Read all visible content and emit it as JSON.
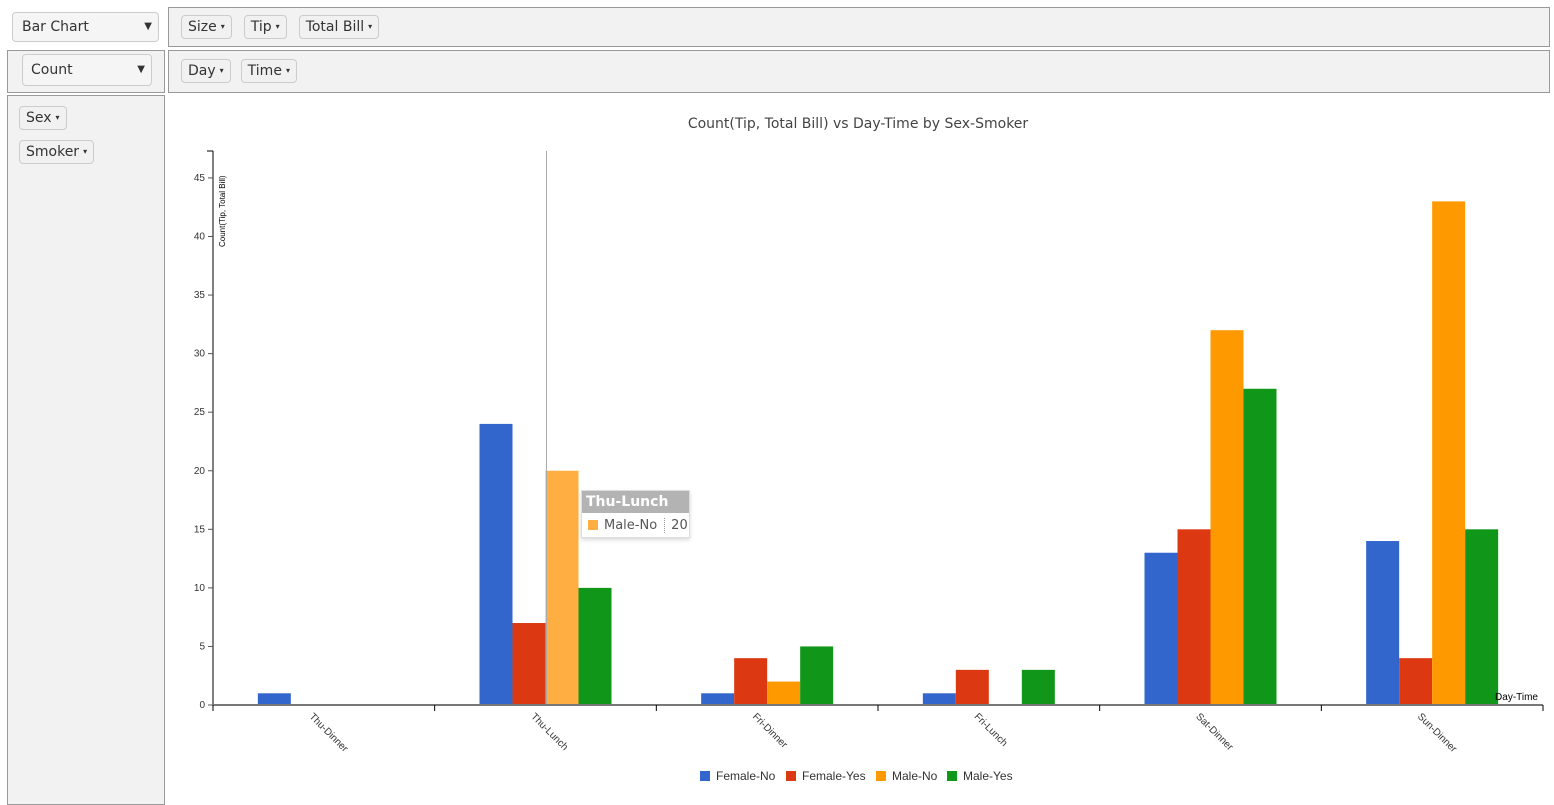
{
  "controls": {
    "renderer": "Bar Chart",
    "aggregator": "Count",
    "unused_attrs": [
      "Size",
      "Tip",
      "Total Bill"
    ],
    "col_attrs": [
      "Day",
      "Time"
    ],
    "row_attrs": [
      "Sex",
      "Smoker"
    ],
    "caret": "▾",
    "select_caret": "▼"
  },
  "tooltip": {
    "title": "Thu-Lunch",
    "series": "Male-No",
    "value": "20",
    "color": "#ffae42"
  },
  "chart_data": {
    "type": "bar",
    "title": "Count(Tip, Total Bill) vs Day-Time by Sex-Smoker",
    "xlabel": "Day-Time",
    "ylabel": "Count(Tip, Total Bill)",
    "ylim": [
      0,
      47.3
    ],
    "yticks": [
      0,
      5,
      10,
      15,
      20,
      25,
      30,
      35,
      40,
      45
    ],
    "grid": false,
    "legend": "bottom-center",
    "categories": [
      "Thu-Dinner",
      "Thu-Lunch",
      "Fri-Dinner",
      "Fri-Lunch",
      "Sat-Dinner",
      "Sun-Dinner"
    ],
    "series": [
      {
        "name": "Female-No",
        "color": "#3366cc",
        "values": [
          1,
          24,
          1,
          1,
          13,
          14
        ]
      },
      {
        "name": "Female-Yes",
        "color": "#dc3912",
        "values": [
          0,
          7,
          4,
          3,
          15,
          4
        ]
      },
      {
        "name": "Male-No",
        "color": "#ff9900",
        "values": [
          0,
          20,
          2,
          0,
          32,
          43
        ]
      },
      {
        "name": "Male-Yes",
        "color": "#109618",
        "values": [
          0,
          10,
          5,
          3,
          27,
          15
        ]
      }
    ],
    "highlight": {
      "category": "Thu-Lunch",
      "series": "Male-No"
    }
  }
}
